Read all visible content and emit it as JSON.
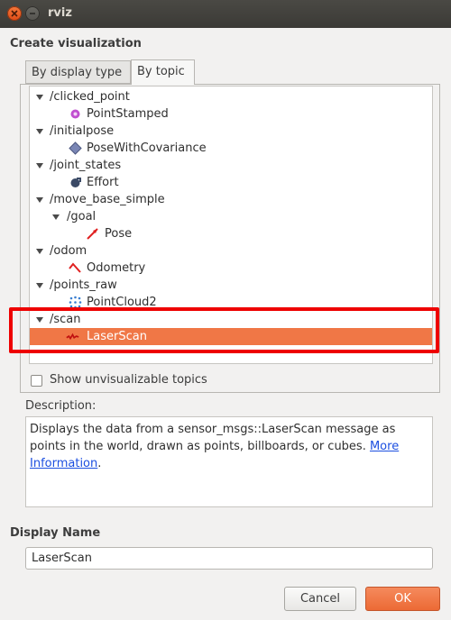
{
  "window": {
    "title": "rviz"
  },
  "create_visualization": {
    "title": "Create visualization",
    "tabs": [
      "By display type",
      "By topic"
    ],
    "active_tab": "By topic",
    "tree": [
      {
        "label": "/clicked_point",
        "type": "topic",
        "expanded": true
      },
      {
        "label": "PointStamped",
        "type": "display",
        "icon": "point-stamped-icon"
      },
      {
        "label": "/initialpose",
        "type": "topic",
        "expanded": true
      },
      {
        "label": "PoseWithCovariance",
        "type": "display",
        "icon": "pose-with-covariance-icon"
      },
      {
        "label": "/joint_states",
        "type": "topic",
        "expanded": true
      },
      {
        "label": "Effort",
        "type": "display",
        "icon": "effort-icon"
      },
      {
        "label": "/move_base_simple",
        "type": "topic",
        "expanded": true
      },
      {
        "label": "/goal",
        "type": "topic",
        "expanded": true
      },
      {
        "label": "Pose",
        "type": "display",
        "icon": "pose-arrow-icon"
      },
      {
        "label": "/odom",
        "type": "topic",
        "expanded": true
      },
      {
        "label": "Odometry",
        "type": "display",
        "icon": "odometry-icon"
      },
      {
        "label": "/points_raw",
        "type": "topic",
        "expanded": true
      },
      {
        "label": "PointCloud2",
        "type": "display",
        "icon": "point-cloud-icon"
      },
      {
        "label": "/scan",
        "type": "topic",
        "expanded": true
      },
      {
        "label": "LaserScan",
        "type": "display",
        "icon": "laser-scan-icon",
        "selected": true
      }
    ],
    "show_unvisualizable": {
      "label": "Show unvisualizable topics",
      "checked": false
    }
  },
  "description": {
    "label": "Description:",
    "text": "Displays the data from a sensor_msgs::LaserScan message as points in the world, drawn as points, billboards, or cubes. ",
    "link_text": "More Information",
    "suffix": "."
  },
  "display_name": {
    "label": "Display Name",
    "value": "LaserScan"
  },
  "buttons": {
    "cancel": "Cancel",
    "ok": "OK"
  },
  "colors": {
    "selection": "#f07746",
    "highlight_box": "#ee0000",
    "ok_button": "#ec6a35"
  }
}
